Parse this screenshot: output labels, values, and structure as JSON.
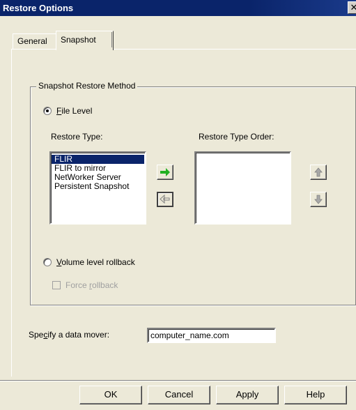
{
  "window": {
    "title": "Restore Options",
    "close_glyph": "✕"
  },
  "tabs": [
    {
      "label": "General",
      "selected": false
    },
    {
      "label": "Snapshot",
      "selected": true
    }
  ],
  "group": {
    "label": "Snapshot Restore Method",
    "file_level": {
      "label_prefix": "",
      "accel": "F",
      "label_rest": "ile Level",
      "checked": true
    },
    "restore_type_label": "Restore Type:",
    "restore_type_order_label": "Restore Type Order:",
    "restore_types": [
      "FLIR",
      "FLIR to mirror",
      "NetWorker Server",
      "Persistent Snapshot"
    ],
    "selected_restore_type": "FLIR",
    "restore_type_order": [],
    "volume_level": {
      "accel": "V",
      "label_rest": "olume level rollback",
      "checked": false
    },
    "force_rollback": {
      "label_prefix": "Force ",
      "accel": "r",
      "label_rest": "ollback",
      "checked": false,
      "enabled": false
    }
  },
  "data_mover": {
    "label_prefix": "Spe",
    "accel": "c",
    "label_rest": "ify a data mover:",
    "value": "computer_name.com"
  },
  "buttons": {
    "ok": "OK",
    "cancel": "Cancel",
    "apply": "Apply",
    "help": "Help"
  },
  "icons": {
    "add_arrow": "arrow-right-icon",
    "remove_arrow": "arrow-left-icon",
    "move_up": "move-up-icon",
    "move_down": "move-down-icon"
  },
  "colors": {
    "title_bar": "#0a246a",
    "selection": "#0a246a",
    "add_arrow": "#22b022"
  }
}
